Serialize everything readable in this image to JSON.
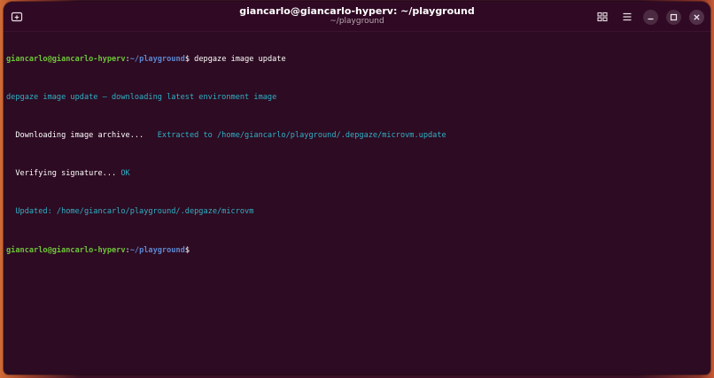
{
  "window": {
    "title": "giancarlo@giancarlo-hyperv: ~/playground",
    "subtitle": "~/playground"
  },
  "header_icons": {
    "new_tab": "new-tab-icon",
    "view": "grid-view-icon",
    "menu": "hamburger-menu-icon",
    "minimize": "minimize-icon",
    "maximize": "maximize-icon",
    "close": "close-icon"
  },
  "colors": {
    "terminal_background": "#2d0b22",
    "prompt_user": "#6ec53a",
    "prompt_path": "#5d87d1",
    "info_text": "#2fb1c7"
  },
  "terminal": {
    "lines": [
      {
        "user": "giancarlo@giancarlo-hyperv",
        "sep": ":",
        "path": "~/playground",
        "dollar": "$",
        "command": " depgaze image update"
      },
      {
        "text": "depgaze image update — downloading latest environment image"
      },
      {
        "text_a": "  Downloading image archive...",
        "text_b": "   Extracted to /home/giancarlo/playground/.depgaze/microvm.update"
      },
      {
        "text_a": "  Verifying signature... ",
        "text_b": "OK"
      },
      {
        "text": "  Updated: /home/giancarlo/playground/.depgaze/microvm"
      },
      {
        "user": "giancarlo@giancarlo-hyperv",
        "sep": ":",
        "path": "~/playground",
        "dollar": "$",
        "command": ""
      }
    ]
  }
}
